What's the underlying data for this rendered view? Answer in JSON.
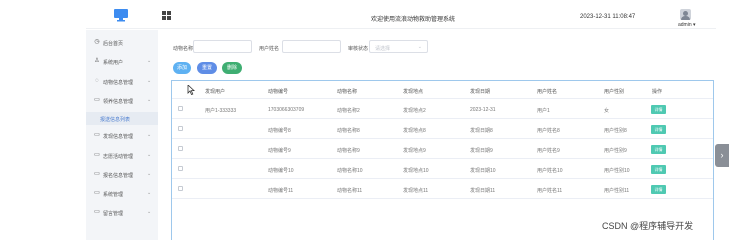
{
  "header": {
    "title": "欢迎使用流浪动物救助管理系统",
    "clock": "2023-12-31 11:08:47",
    "user": "admin ▾",
    "monitor_icon": "monitor-icon",
    "menu_icon": "grid-icon"
  },
  "sidebar": {
    "items": [
      {
        "label": "后台首页",
        "icon": "clock-icon",
        "glyph": "◷",
        "chevron": ""
      },
      {
        "label": "系统用户",
        "icon": "user-icon",
        "glyph": "♙",
        "chevron": "⌄"
      },
      {
        "label": "动物信息管理",
        "icon": "paw-icon",
        "glyph": "◌",
        "chevron": "⌄"
      },
      {
        "label": "领养信息管理",
        "icon": "doc-icon",
        "glyph": "▭",
        "chevron": "⌄"
      },
      {
        "label": "报送信息列表",
        "icon": "",
        "glyph": "",
        "chevron": ""
      },
      {
        "label": "发现信息管理",
        "icon": "doc-icon",
        "glyph": "▭",
        "chevron": "⌄"
      },
      {
        "label": "志愿活动管理",
        "icon": "doc-icon",
        "glyph": "▭",
        "chevron": "⌄"
      },
      {
        "label": "报名信息管理",
        "icon": "doc-icon",
        "glyph": "▭",
        "chevron": "⌄"
      },
      {
        "label": "系统管理",
        "icon": "folder-icon",
        "glyph": "▭",
        "chevron": "⌄"
      },
      {
        "label": "留言管理",
        "icon": "folder-icon",
        "glyph": "▭",
        "chevron": "⌄"
      }
    ]
  },
  "filters": {
    "animal_name_label": "动物名称",
    "username_label": "用户姓名",
    "review_status_label": "审核状态",
    "review_status_placeholder": "请选择",
    "dropdown_icon": "⌄"
  },
  "toolbar": {
    "add_label": "添加",
    "reset_label": "重置",
    "delete_label": "删除"
  },
  "table": {
    "headers": [
      "发现用户",
      "动物编号",
      "动物名称",
      "发现地点",
      "发现日期",
      "用户姓名",
      "用户性别",
      "操作"
    ],
    "rows": [
      [
        "用户1-333333",
        "1703066303709",
        "动物名称2",
        "发现地点2",
        "2023-12-31",
        "用户1",
        "女",
        "详情"
      ],
      [
        "",
        "动物编号8",
        "动物名称8",
        "发现地点8",
        "发现日期8",
        "用户姓名8",
        "用户性别8",
        "详情"
      ],
      [
        "",
        "动物编号9",
        "动物名称9",
        "发现地点9",
        "发现日期9",
        "用户姓名9",
        "用户性别9",
        "详情"
      ],
      [
        "",
        "动物编号10",
        "动物名称10",
        "发现地点10",
        "发现日期10",
        "用户姓名10",
        "用户性别10",
        "详情"
      ],
      [
        "",
        "动物编号11",
        "动物名称11",
        "发现地点11",
        "发现日期11",
        "用户姓名11",
        "用户性别11",
        "详情"
      ]
    ]
  },
  "side_tab": {
    "glyph": "›"
  },
  "watermark": "CSDN @程序辅导开发"
}
